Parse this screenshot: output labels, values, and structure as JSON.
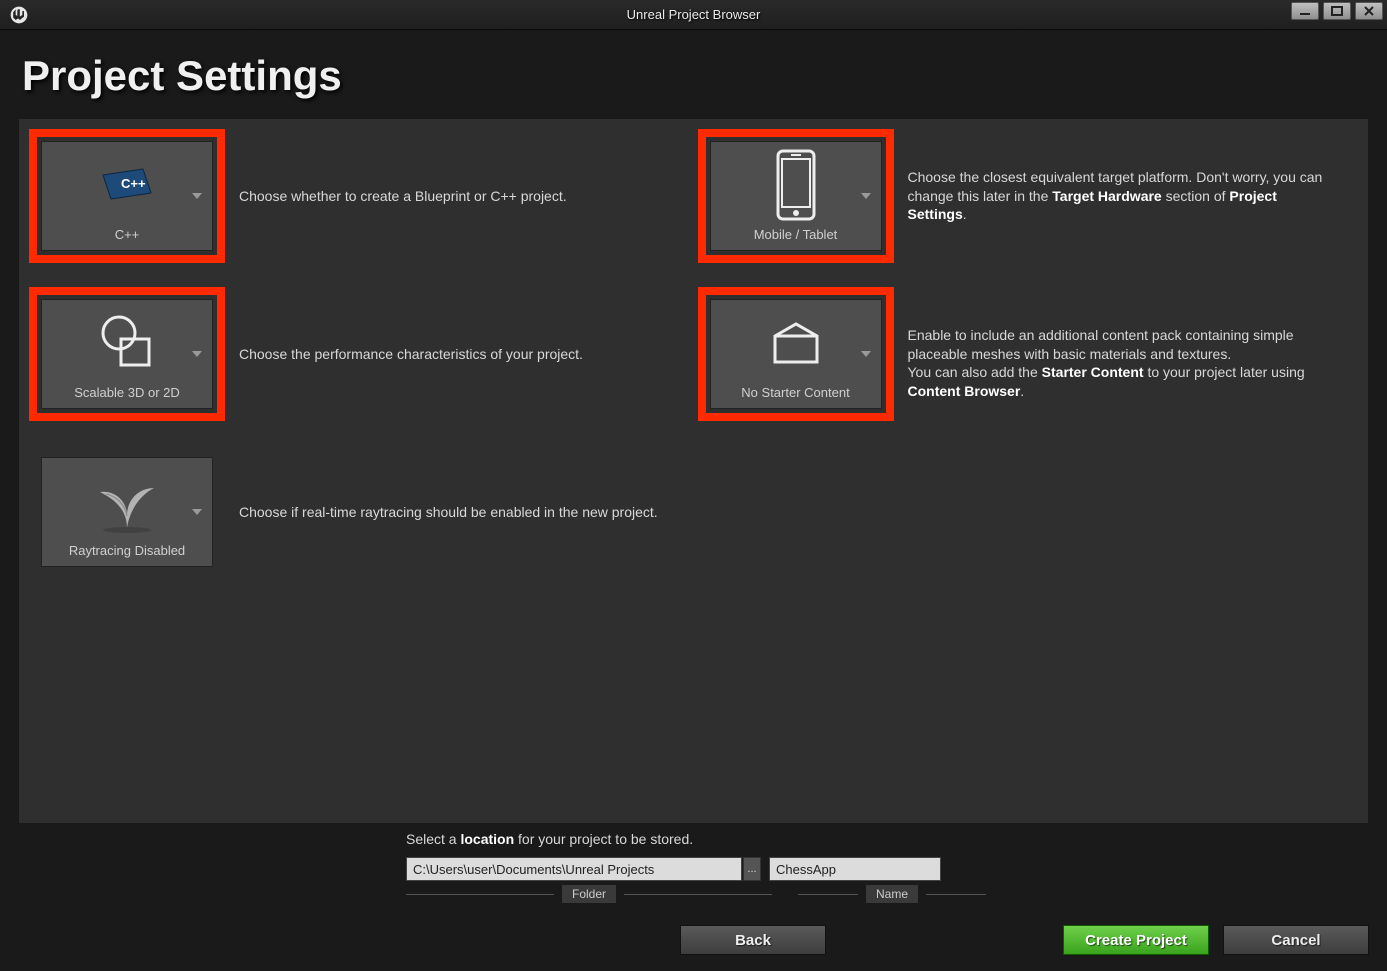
{
  "window": {
    "title": "Unreal Project Browser"
  },
  "heading": "Project Settings",
  "options": {
    "project_type": {
      "label": "C++",
      "highlighted": true,
      "desc": "Choose whether to create a Blueprint or C++ project."
    },
    "platform": {
      "label": "Mobile / Tablet",
      "highlighted": true,
      "desc_pre": "Choose the closest equivalent target platform. Don't worry, you can change this later in the ",
      "desc_b1": "Target Hardware",
      "desc_mid": " section of ",
      "desc_b2": "Project Settings",
      "desc_post": "."
    },
    "quality": {
      "label": "Scalable 3D or 2D",
      "highlighted": true,
      "desc": "Choose the performance characteristics of your project."
    },
    "starter": {
      "label": "No Starter Content",
      "highlighted": true,
      "desc_pre": "Enable to include an additional content pack containing simple placeable meshes with basic materials and textures.\nYou can also add the ",
      "desc_b1": "Starter Content",
      "desc_mid": " to your project later using ",
      "desc_b2": "Content Browser",
      "desc_post": "."
    },
    "raytracing": {
      "label": "Raytracing Disabled",
      "highlighted": false,
      "desc": "Choose if real-time raytracing should be enabled in the new project."
    }
  },
  "location": {
    "prompt_pre": "Select a ",
    "prompt_b": "location",
    "prompt_post": " for your project to be stored.",
    "folder_value": "C:\\Users\\user\\Documents\\Unreal Projects",
    "folder_label": "Folder",
    "name_value": "ChessApp",
    "name_label": "Name",
    "browse_label": "..."
  },
  "buttons": {
    "back": "Back",
    "create": "Create Project",
    "cancel": "Cancel"
  },
  "colors": {
    "highlight": "#ff2a00",
    "accent_green": "#4cb82e"
  }
}
